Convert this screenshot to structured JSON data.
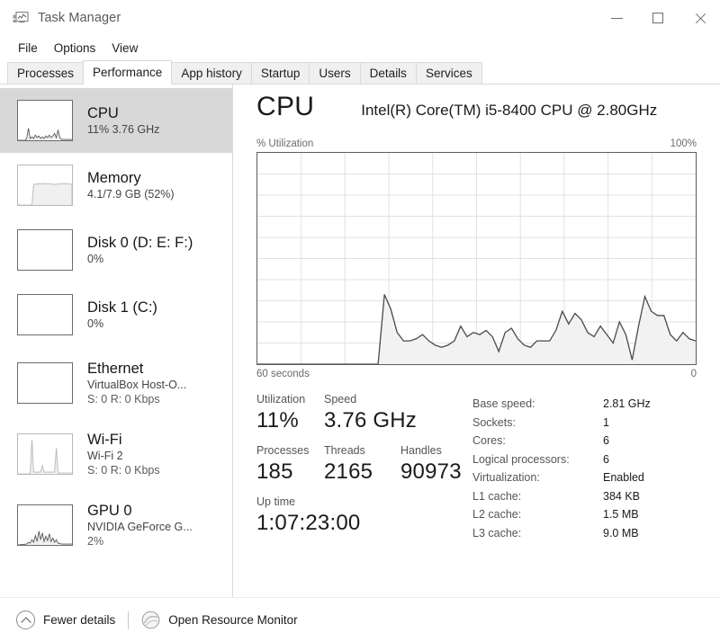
{
  "window": {
    "title": "Task Manager",
    "icon": "task-manager-icon",
    "controls": {
      "minimize": "minimize",
      "maximize": "maximize",
      "close": "close"
    }
  },
  "menubar": {
    "items": [
      "File",
      "Options",
      "View"
    ]
  },
  "tabs": {
    "items": [
      "Processes",
      "Performance",
      "App history",
      "Startup",
      "Users",
      "Details",
      "Services"
    ],
    "active": "Performance"
  },
  "sidebar": {
    "items": [
      {
        "name": "CPU",
        "line2": "11%  3.76 GHz",
        "line3": "",
        "selected": true,
        "graph": "cpu"
      },
      {
        "name": "Memory",
        "line2": "4.1/7.9 GB (52%)",
        "line3": "",
        "selected": false,
        "graph": "memory"
      },
      {
        "name": "Disk 0 (D: E: F:)",
        "line2": "0%",
        "line3": "",
        "selected": false,
        "graph": "flat"
      },
      {
        "name": "Disk 1 (C:)",
        "line2": "0%",
        "line3": "",
        "selected": false,
        "graph": "flat"
      },
      {
        "name": "Ethernet",
        "line2": "VirtualBox Host-O...",
        "line3": "S: 0 R: 0 Kbps",
        "selected": false,
        "graph": "flat"
      },
      {
        "name": "Wi-Fi",
        "line2": "Wi-Fi 2",
        "line3": "S: 0 R: 0 Kbps",
        "selected": false,
        "graph": "wifi"
      },
      {
        "name": "GPU 0",
        "line2": "NVIDIA GeForce G...",
        "line3": "2%",
        "selected": false,
        "graph": "gpu"
      }
    ]
  },
  "main": {
    "title": "CPU",
    "subtitle": "Intel(R) Core(TM) i5-8400 CPU @ 2.80GHz",
    "axis_top_left": "% Utilization",
    "axis_top_right": "100%",
    "axis_bottom_left": "60 seconds",
    "axis_bottom_right": "0",
    "stats": {
      "utilization_label": "Utilization",
      "utilization_value": "11%",
      "speed_label": "Speed",
      "speed_value": "3.76 GHz",
      "processes_label": "Processes",
      "processes_value": "185",
      "threads_label": "Threads",
      "threads_value": "2165",
      "handles_label": "Handles",
      "handles_value": "90973",
      "uptime_label": "Up time",
      "uptime_value": "1:07:23:00"
    },
    "specs": [
      {
        "label": "Base speed:",
        "value": "2.81 GHz"
      },
      {
        "label": "Sockets:",
        "value": "1"
      },
      {
        "label": "Cores:",
        "value": "6"
      },
      {
        "label": "Logical processors:",
        "value": "6"
      },
      {
        "label": "Virtualization:",
        "value": "Enabled"
      },
      {
        "label": "L1 cache:",
        "value": "384 KB"
      },
      {
        "label": "L2 cache:",
        "value": "1.5 MB"
      },
      {
        "label": "L3 cache:",
        "value": "9.0 MB"
      }
    ]
  },
  "footer": {
    "fewer_details": "Fewer details",
    "open_resource_monitor": "Open Resource Monitor"
  },
  "colors": {
    "graph_line": "#4a4a4a",
    "graph_fill": "#f2f2f2",
    "grid": "#e2e2e2",
    "selection": "#d8d8d8",
    "border": "#5d5d5d"
  },
  "chart_data": {
    "type": "area",
    "title": "% Utilization",
    "xlabel": "60 seconds",
    "ylabel": "% Utilization",
    "xlim": [
      60,
      0
    ],
    "ylim": [
      0,
      100
    ],
    "grid": true,
    "gridlines_x": 10,
    "gridlines_y": 10,
    "current_value": 11,
    "max_value": 100,
    "series": [
      {
        "name": "CPU Utilization",
        "values": [
          0,
          0,
          0,
          0,
          0,
          0,
          0,
          0,
          0,
          0,
          0,
          0,
          0,
          0,
          0,
          0,
          0,
          0,
          0,
          0,
          33,
          26,
          15,
          11,
          11,
          12,
          14,
          11,
          9,
          8,
          9,
          11,
          18,
          13,
          15,
          14,
          16,
          13,
          6,
          15,
          17,
          12,
          9,
          8,
          11,
          11,
          11,
          16,
          25,
          19,
          24,
          21,
          15,
          13,
          18,
          14,
          10,
          20,
          14,
          2,
          18,
          32,
          25,
          23,
          23,
          14,
          11,
          15,
          12,
          11
        ]
      }
    ]
  }
}
